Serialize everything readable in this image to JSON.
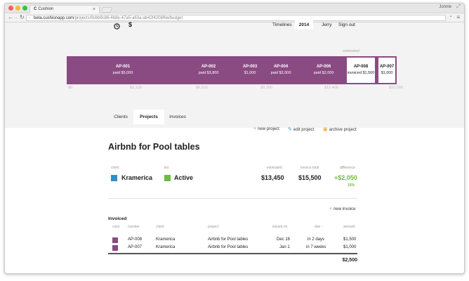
{
  "browser": {
    "tab_title": "Cushion",
    "tab_close": "×",
    "user": "Jonnie",
    "url_host": "beta.cushionapp.com",
    "url_path": "/projects/9cbb9c86-4b8e-47a5-a63a-ab42f4206f6e/budget"
  },
  "header": {
    "clock_icon": "clock-icon",
    "dollar_icon": "$",
    "nav": {
      "timelines": "Timelines",
      "year": "2014",
      "user": "Jerry",
      "signout": "Sign out"
    }
  },
  "timeline": {
    "estimated_label": "estimated",
    "segments": [
      {
        "code": "AP-001",
        "amount": "paid $5,000"
      },
      {
        "code": "AP-002",
        "amount": "paid $3,800"
      },
      {
        "code": "AP-003",
        "amount": "$1,000"
      },
      {
        "code": "AP-004",
        "amount": "paid $2,000"
      },
      {
        "code": "AP-006",
        "amount": "paid $2,000"
      },
      {
        "code": "AP-008",
        "amount": "invoiced $1,500"
      },
      {
        "code": "AP-007",
        "amount": "$1,000"
      }
    ],
    "axis": [
      "$0",
      "$3,100",
      "$6,200",
      "$9,300",
      "$12,400",
      "$15,500"
    ],
    "colors": {
      "paid": "#8a4a82"
    }
  },
  "tabs": [
    "Clients",
    "Projects",
    "Invoices"
  ],
  "actions": {
    "new_project": "new project",
    "edit_project": "edit project",
    "archive_project": "archive project"
  },
  "project": {
    "title": "Airbnb for Pool tables",
    "client_label": "client",
    "client": "Kramerica",
    "client_color": "#2f8fce",
    "list_label": "list",
    "list": "Active",
    "list_color": "#6cbd3c",
    "estimated_label": "estimated",
    "estimated": "$13,450",
    "invoice_total_label": "invoice total",
    "invoice_total": "$15,500",
    "difference_label": "difference",
    "difference": "+$2,050",
    "difference_pct": "15%"
  },
  "invoices": {
    "new_invoice": "new invoice",
    "section_title": "Invoiced",
    "columns": [
      "color",
      "number",
      "client",
      "project",
      "issued on",
      "due ↑",
      "amount"
    ],
    "rows": [
      {
        "number": "AP-008",
        "client": "Kramerica",
        "project": "Airbnb for Pool tables",
        "issued": "Dec 16",
        "due": "in 2 days",
        "amount": "$1,500"
      },
      {
        "number": "AP-007",
        "client": "Kramerica",
        "project": "Airbnb for Pool tables",
        "issued": "Jan 1",
        "due": "in 7 weeks",
        "amount": "$1,000"
      }
    ],
    "total": "$2,500"
  }
}
